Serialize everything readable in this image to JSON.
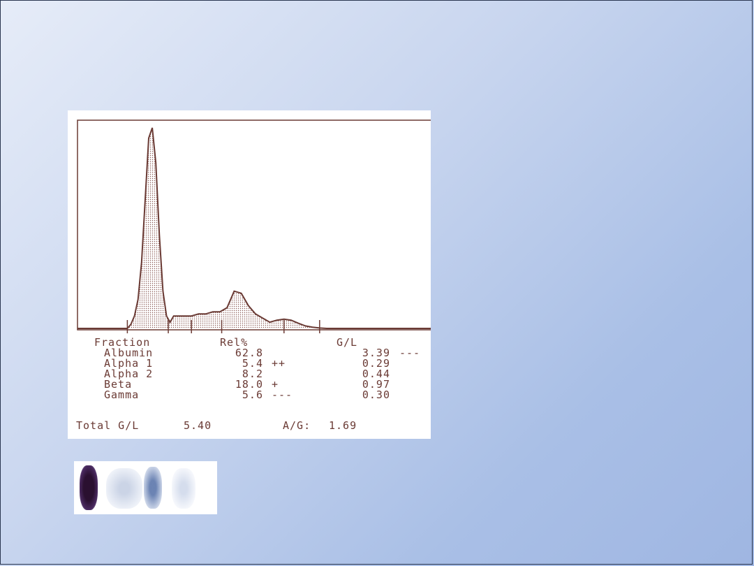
{
  "colors": {
    "ink": "#6a3a34",
    "fill_dots": "#8a5a54",
    "gel_dark": "#2a1030",
    "gel_blue": "#3a5a9a"
  },
  "chart_data": {
    "type": "area",
    "title": "",
    "xlabel": "",
    "ylabel": "",
    "xlim": [
      0,
      100
    ],
    "ylim": [
      0,
      100
    ],
    "grid": false,
    "profile": {
      "x": [
        0,
        14,
        15,
        16,
        17,
        18,
        19,
        20,
        21,
        22,
        23,
        24,
        25,
        26,
        27,
        28,
        30,
        32,
        34,
        36,
        38,
        40,
        42,
        44,
        46,
        48,
        50,
        52,
        54,
        56,
        58,
        60,
        62,
        64,
        66,
        68,
        70,
        72,
        74,
        76,
        100
      ],
      "y": [
        0,
        0,
        2,
        6,
        14,
        32,
        62,
        92,
        97,
        80,
        45,
        18,
        6,
        3,
        6,
        6,
        6,
        6,
        7,
        7,
        8,
        8,
        10,
        18,
        17,
        11,
        7,
        5,
        3,
        4,
        4.5,
        4,
        2.5,
        1.2,
        0.6,
        0.2,
        0,
        0,
        0,
        0,
        0
      ]
    },
    "fraction_boundaries_x": [
      14,
      25.5,
      32,
      40.5,
      58,
      68
    ],
    "table": {
      "headers": [
        "Fraction",
        "Rel%",
        "",
        "G/L",
        ""
      ],
      "rows": [
        {
          "fraction": "Albumin",
          "rel": "62.8",
          "rel_flag": "",
          "gl": "3.39",
          "gl_flag": "---"
        },
        {
          "fraction": "Alpha 1",
          "rel": "5.4",
          "rel_flag": "++",
          "gl": "0.29",
          "gl_flag": ""
        },
        {
          "fraction": "Alpha 2",
          "rel": "8.2",
          "rel_flag": "",
          "gl": "0.44",
          "gl_flag": ""
        },
        {
          "fraction": "Beta",
          "rel": "18.0",
          "rel_flag": "+",
          "gl": "0.97",
          "gl_flag": ""
        },
        {
          "fraction": "Gamma",
          "rel": "5.6",
          "rel_flag": "---",
          "gl": "0.30",
          "gl_flag": ""
        }
      ]
    },
    "summary": {
      "total_label": "Total G/L",
      "total_value": "5.40",
      "ag_label": "A/G:",
      "ag_value": "1.69"
    }
  }
}
